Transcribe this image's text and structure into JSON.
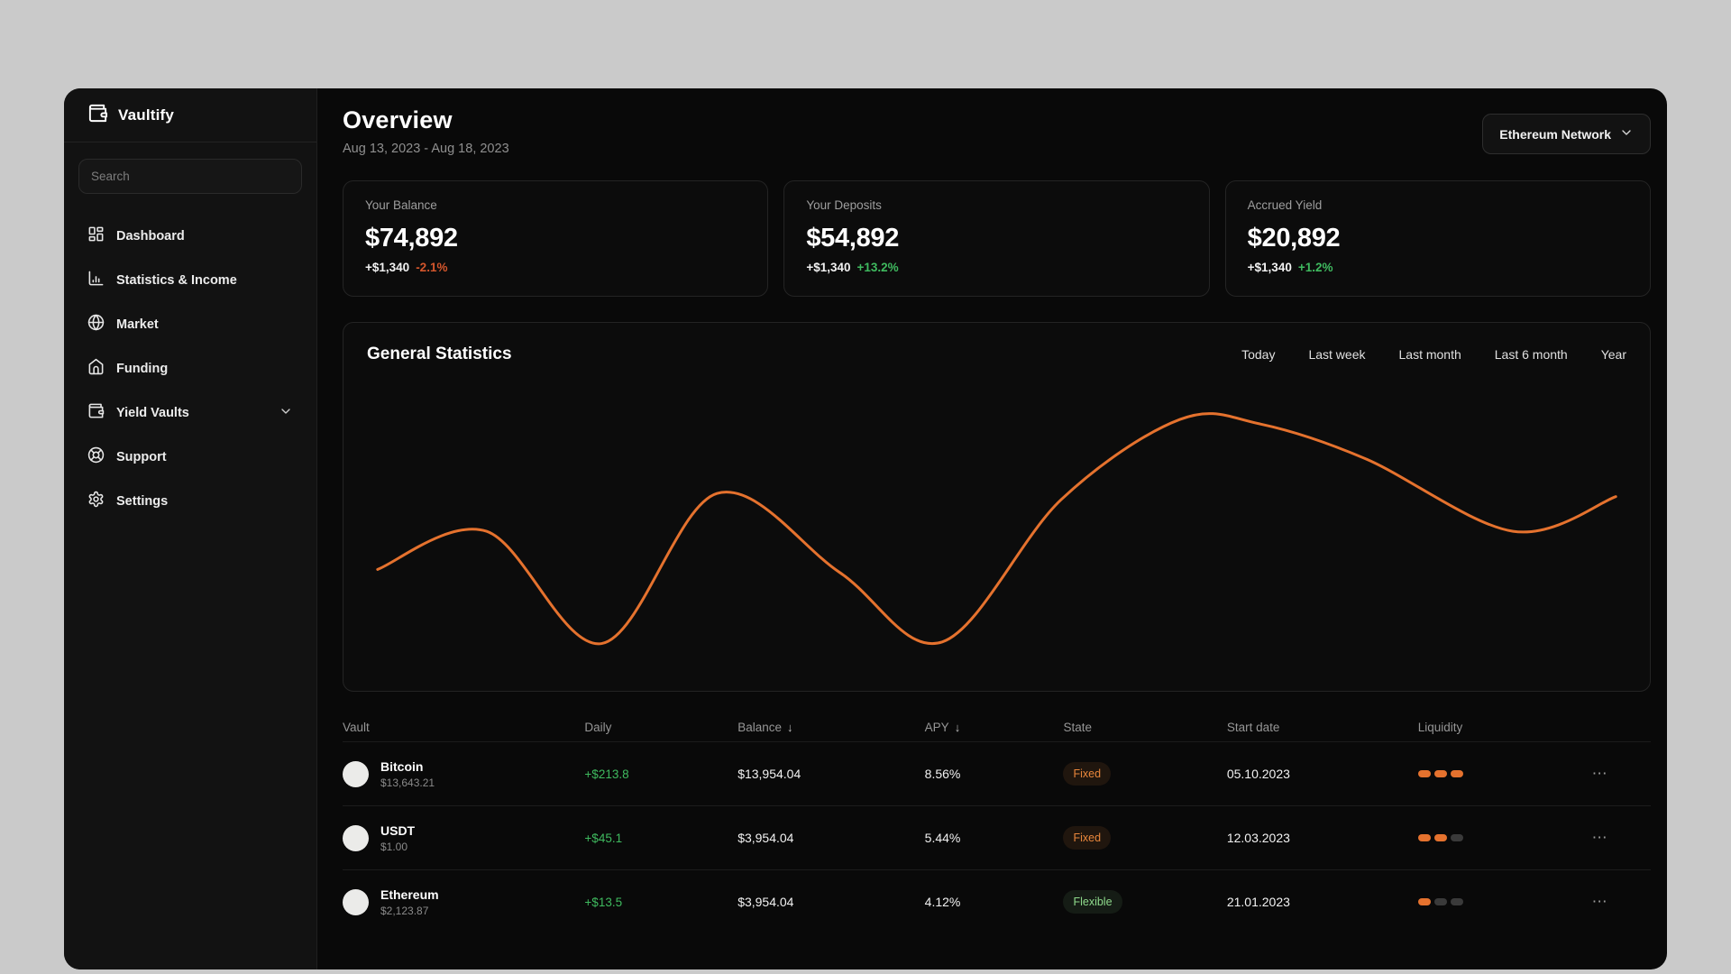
{
  "colors": {
    "accent": "#e5722e",
    "positive": "#3fba5f",
    "negative": "#d4562c"
  },
  "app": {
    "name": "Vaultify",
    "logo_icon": "wallet-icon"
  },
  "sidebar": {
    "search": {
      "placeholder": "Search"
    },
    "items": [
      {
        "label": "Dashboard",
        "icon": "dashboard-grid-icon"
      },
      {
        "label": "Statistics & Income",
        "icon": "bar-chart-icon"
      },
      {
        "label": "Market",
        "icon": "globe-icon"
      },
      {
        "label": "Funding",
        "icon": "home-icon"
      },
      {
        "label": "Yield Vaults",
        "icon": "wallet-icon",
        "chevron": "chevron-down-icon"
      },
      {
        "label": "Support",
        "icon": "lifebuoy-icon"
      },
      {
        "label": "Settings",
        "icon": "gear-icon"
      }
    ]
  },
  "header": {
    "title": "Overview",
    "date_range": "Aug 13, 2023 - Aug 18, 2023",
    "network_selector": {
      "label": "Ethereum Network",
      "icon": "chevron-down-icon"
    }
  },
  "stat_cards": [
    {
      "label": "Your Balance",
      "value": "$74,892",
      "delta_abs": "+$1,340",
      "delta_pct": "-2.1%",
      "delta_direction": "down"
    },
    {
      "label": "Your Deposits",
      "value": "$54,892",
      "delta_abs": "+$1,340",
      "delta_pct": "+13.2%",
      "delta_direction": "up"
    },
    {
      "label": "Accrued Yield",
      "value": "$20,892",
      "delta_abs": "+$1,340",
      "delta_pct": "+1.2%",
      "delta_direction": "up"
    }
  ],
  "statistics_panel": {
    "title": "General Statistics",
    "filters": [
      "Today",
      "Last week",
      "Last month",
      "Last 6 month",
      "Year"
    ]
  },
  "chart_data": {
    "type": "line",
    "title": "General Statistics",
    "color": "#e5722e",
    "grid": false,
    "axes_visible": false,
    "x_range": [
      0,
      100
    ],
    "y_range": [
      0,
      100
    ],
    "points": [
      [
        0,
        37.6
      ],
      [
        8.8,
        52.4
      ],
      [
        18.1,
        8.8
      ],
      [
        27.4,
        67.1
      ],
      [
        37.3,
        36.5
      ],
      [
        45.6,
        9.4
      ],
      [
        55.2,
        64.7
      ],
      [
        64.8,
        95.9
      ],
      [
        71.3,
        94.1
      ],
      [
        79.8,
        80.6
      ],
      [
        91.7,
        52.4
      ],
      [
        100,
        65.9
      ]
    ]
  },
  "table": {
    "columns": [
      {
        "label": "Vault"
      },
      {
        "label": "Daily"
      },
      {
        "label": "Balance",
        "sort_icon": "↓"
      },
      {
        "label": "APY",
        "sort_icon": "↓"
      },
      {
        "label": "State"
      },
      {
        "label": "Start date"
      },
      {
        "label": "Liquidity"
      }
    ],
    "rows": [
      {
        "name": "Bitcoin",
        "price": "$13,643.21",
        "daily": "+$213.8",
        "balance": "$13,954.04",
        "apy": "8.56%",
        "state": "Fixed",
        "state_type": "fixed",
        "start_date": "05.10.2023",
        "liquidity": 3
      },
      {
        "name": "USDT",
        "price": "$1.00",
        "daily": "+$45.1",
        "balance": "$3,954.04",
        "apy": "5.44%",
        "state": "Fixed",
        "state_type": "fixed",
        "start_date": "12.03.2023",
        "liquidity": 2
      },
      {
        "name": "Ethereum",
        "price": "$2,123.87",
        "daily": "+$13.5",
        "balance": "$3,954.04",
        "apy": "4.12%",
        "state": "Flexible",
        "state_type": "flexible",
        "start_date": "21.01.2023",
        "liquidity": 1
      }
    ],
    "row_menu_icon": "⋯"
  }
}
